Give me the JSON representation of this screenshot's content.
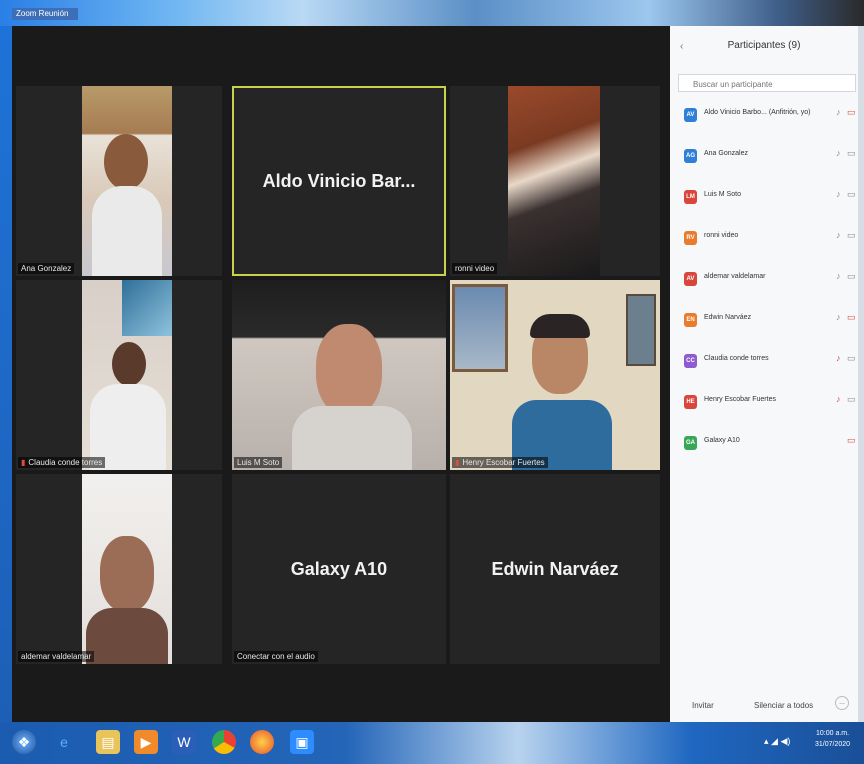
{
  "window": {
    "app_title": "Zoom Reunión"
  },
  "tiles": [
    {
      "name": "Ana Gonzalez"
    },
    {
      "name": "Aldo Vinicio Bar..."
    },
    {
      "name": "ronni video"
    },
    {
      "name": "Claudia conde torres"
    },
    {
      "name": "Luis M Soto"
    },
    {
      "name": "Henry Escobar Fuertes"
    },
    {
      "name": "aldemar valdelamar"
    },
    {
      "name": "Galaxy A10",
      "audio_label": "Conectar con el audio"
    },
    {
      "name": "Edwin Narváez"
    }
  ],
  "panel": {
    "title": "Participantes (9)",
    "back_icon": "‹",
    "search_placeholder": "Buscar un participante",
    "participants": [
      {
        "initials": "AV",
        "name": "Aldo Vinicio Barbo... (Anfitrión, yo)",
        "color": "#2f7fd6",
        "mic": "on",
        "cam": "off"
      },
      {
        "initials": "AG",
        "name": "Ana Gonzalez",
        "color": "#2f7fd6",
        "mic": "on",
        "cam": "on"
      },
      {
        "initials": "LM",
        "name": "Luis M Soto",
        "color": "#d9463b",
        "mic": "on",
        "cam": "on"
      },
      {
        "initials": "RV",
        "name": "ronni video",
        "color": "#e87b2c",
        "mic": "on",
        "cam": "on"
      },
      {
        "initials": "AV",
        "name": "aldemar valdelamar",
        "color": "#d9463b",
        "mic": "on",
        "cam": "on"
      },
      {
        "initials": "EN",
        "name": "Edwin Narváez",
        "color": "#e87b2c",
        "mic": "on",
        "cam": "off"
      },
      {
        "initials": "CC",
        "name": "Claudia conde torres",
        "color": "#8e5bd0",
        "mic": "off",
        "cam": "on"
      },
      {
        "initials": "HE",
        "name": "Henry Escobar Fuertes",
        "color": "#d9463b",
        "mic": "off",
        "cam": "on"
      },
      {
        "initials": "GA",
        "name": "Galaxy A10",
        "color": "#3aa758",
        "mic": "none",
        "cam": "off"
      }
    ],
    "invite_label": "Invitar",
    "mute_all_label": "Silenciar a todos",
    "more_label": "..."
  },
  "taskbar": {
    "clock_time": "10:00 a.m.",
    "clock_date": "31/07/2020"
  }
}
